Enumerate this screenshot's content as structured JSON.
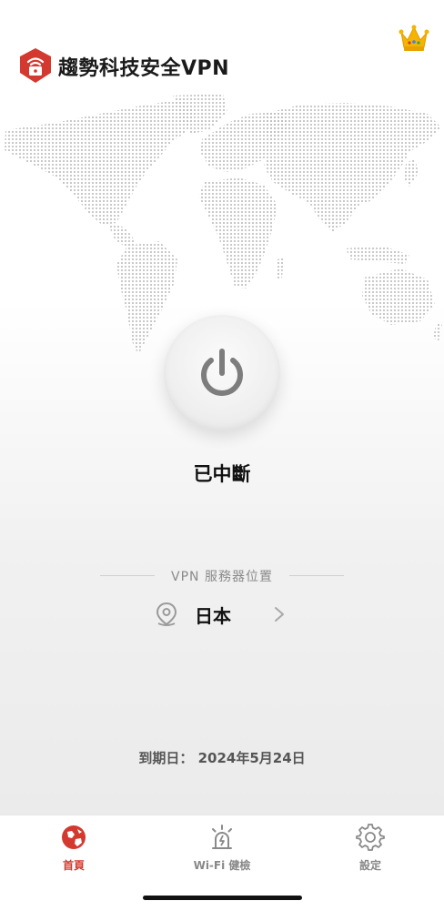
{
  "app": {
    "title": "趨勢科技安全VPN"
  },
  "colors": {
    "brand_red": "#d3392f",
    "crown_gold": "#f4b400",
    "map_dot": "#b8b8b8"
  },
  "icons": {
    "logo": "shield-lock-wifi-icon",
    "premium": "crown-icon",
    "power": "power-icon",
    "location": "map-pin-icon",
    "chevron": "chevron-right-icon"
  },
  "connection": {
    "status": "已中斷"
  },
  "server": {
    "section_label": "VPN 服務器位置",
    "location": "日本"
  },
  "expiry": {
    "text": "到期日： 2024年5月24日"
  },
  "tabs": [
    {
      "label": "首頁",
      "icon": "globe-icon",
      "active": true
    },
    {
      "label": "Wi-Fi 健檢",
      "icon": "wifi-alert-icon",
      "active": false
    },
    {
      "label": "設定",
      "icon": "gear-icon",
      "active": false
    }
  ]
}
